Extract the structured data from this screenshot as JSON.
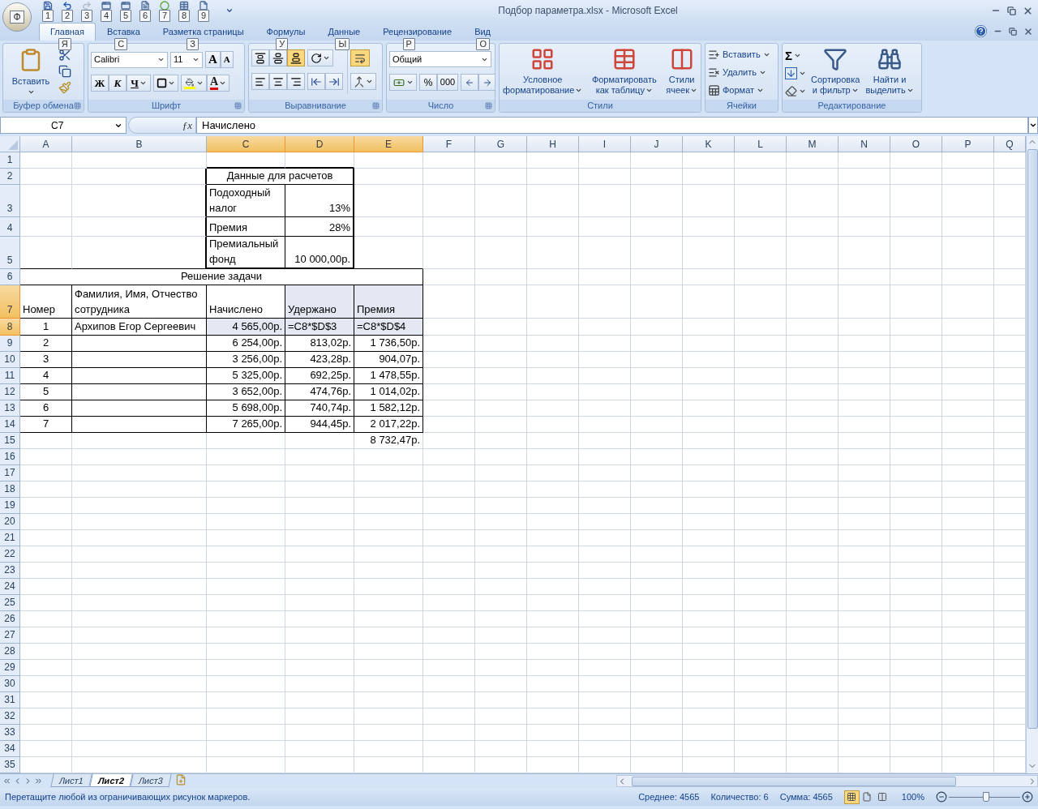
{
  "app": {
    "office_button": "Ф",
    "title": "Подбор параметра.xlsx - Microsoft Excel"
  },
  "quick_access": [
    {
      "kind": "save",
      "keytip": "1",
      "disabled": false
    },
    {
      "kind": "undo",
      "keytip": "2",
      "disabled": false
    },
    {
      "kind": "redo",
      "keytip": "3",
      "disabled": true
    },
    {
      "kind": "form",
      "keytip": "4",
      "disabled": false
    },
    {
      "kind": "form",
      "keytip": "5",
      "disabled": false
    },
    {
      "kind": "document",
      "keytip": "6",
      "disabled": false
    },
    {
      "kind": "circle",
      "keytip": "7",
      "disabled": false
    },
    {
      "kind": "table",
      "keytip": "8",
      "disabled": false
    },
    {
      "kind": "window",
      "keytip": "9",
      "disabled": false
    }
  ],
  "tabs": [
    {
      "label": "Главная",
      "keytip": "Я",
      "selected": true
    },
    {
      "label": "Вставка",
      "keytip": "С",
      "selected": false
    },
    {
      "label": "Разметка страницы",
      "keytip": "З",
      "selected": false
    },
    {
      "label": "Формулы",
      "keytip": "У",
      "selected": false
    },
    {
      "label": "Данные",
      "keytip": "Ы",
      "selected": false
    },
    {
      "label": "Рецензирование",
      "keytip": "Р",
      "selected": false
    },
    {
      "label": "Вид",
      "keytip": "О",
      "selected": false
    }
  ],
  "ribbon": {
    "clipboard": {
      "label": "Буфер обмена",
      "paste": "Вставить"
    },
    "font": {
      "label": "Шрифт",
      "font": "Calibri",
      "size": "11",
      "grow": "A",
      "shrink": "A",
      "bold": "Ж",
      "italic": "К",
      "underline": "Ч",
      "font_color": "A"
    },
    "alignment": {
      "label": "Выравнивание",
      "vertical": [
        {
          "kind": "top",
          "selected": false
        },
        {
          "kind": "middle",
          "selected": false
        },
        {
          "kind": "bottom",
          "selected": true
        }
      ],
      "wrap_text": {
        "selected": true
      }
    },
    "number": {
      "label": "Число",
      "format": "Общий",
      "percent": "%",
      "thousands": "000"
    },
    "styles": {
      "label": "Стили",
      "buttons": [
        {
          "kind": "conditional",
          "lines": [
            "Условное",
            "форматирование"
          ]
        },
        {
          "kind": "table",
          "lines": [
            "Форматировать",
            "как таблицу"
          ]
        },
        {
          "kind": "cell",
          "lines": [
            "Стили",
            "ячеек"
          ]
        }
      ]
    },
    "cells": {
      "label": "Ячейки",
      "buttons": [
        {
          "kind": "insert",
          "label": "Вставить"
        },
        {
          "kind": "delete",
          "label": "Удалить"
        },
        {
          "kind": "format",
          "label": "Формат"
        }
      ]
    },
    "editing": {
      "label": "Редактирование",
      "sum": "Σ",
      "buttons": [
        {
          "kind": "sort",
          "lines": [
            "Сортировка",
            "и фильтр"
          ]
        },
        {
          "kind": "find",
          "lines": [
            "Найти и",
            "выделить"
          ]
        }
      ]
    }
  },
  "formula_bar": {
    "name_box": "C7",
    "function_label": "ƒx",
    "formula": "Начислено"
  },
  "sheet": {
    "column_headers": [
      {
        "label": "A",
        "selected": false
      },
      {
        "label": "B",
        "selected": false
      },
      {
        "label": "C",
        "selected": true
      },
      {
        "label": "D",
        "selected": true
      },
      {
        "label": "E",
        "selected": true
      },
      {
        "label": "F",
        "selected": false
      },
      {
        "label": "G",
        "selected": false
      },
      {
        "label": "H",
        "selected": false
      },
      {
        "label": "I",
        "selected": false
      },
      {
        "label": "J",
        "selected": false
      },
      {
        "label": "K",
        "selected": false
      },
      {
        "label": "L",
        "selected": false
      },
      {
        "label": "M",
        "selected": false
      },
      {
        "label": "N",
        "selected": false
      },
      {
        "label": "O",
        "selected": false
      },
      {
        "label": "P",
        "selected": false
      },
      {
        "label": "Q",
        "selected": false
      }
    ],
    "row_headers": [
      {
        "label": "1",
        "selected": false
      },
      {
        "label": "2",
        "selected": false
      },
      {
        "label": "3",
        "selected": false
      },
      {
        "label": "4",
        "selected": false
      },
      {
        "label": "5",
        "selected": false
      },
      {
        "label": "6",
        "selected": false
      },
      {
        "label": "7",
        "selected": true
      },
      {
        "label": "8",
        "selected": true
      },
      {
        "label": "9",
        "selected": false
      },
      {
        "label": "10",
        "selected": false
      },
      {
        "label": "11",
        "selected": false
      },
      {
        "label": "12",
        "selected": false
      },
      {
        "label": "13",
        "selected": false
      },
      {
        "label": "14",
        "selected": false
      },
      {
        "label": "15",
        "selected": false
      },
      {
        "label": "16",
        "selected": false
      },
      {
        "label": "17",
        "selected": false
      },
      {
        "label": "18",
        "selected": false
      },
      {
        "label": "19",
        "selected": false
      },
      {
        "label": "20",
        "selected": false
      },
      {
        "label": "21",
        "selected": false
      },
      {
        "label": "22",
        "selected": false
      },
      {
        "label": "23",
        "selected": false
      },
      {
        "label": "24",
        "selected": false
      },
      {
        "label": "25",
        "selected": false
      },
      {
        "label": "26",
        "selected": false
      },
      {
        "label": "27",
        "selected": false
      },
      {
        "label": "28",
        "selected": false
      },
      {
        "label": "29",
        "selected": false
      },
      {
        "label": "30",
        "selected": false
      },
      {
        "label": "31",
        "selected": false
      },
      {
        "label": "32",
        "selected": false
      },
      {
        "label": "33",
        "selected": false
      },
      {
        "label": "34",
        "selected": false
      },
      {
        "label": "35",
        "selected": false
      }
    ],
    "data_block": {
      "title": "Данные для расчетов",
      "rows": [
        {
          "label": "Подоходный налог",
          "value": "13%"
        },
        {
          "label": "Премия",
          "value": "28%"
        },
        {
          "label": "Премиальный фонд",
          "value": "10 000,00р."
        }
      ]
    },
    "task": {
      "title": "Решение задачи",
      "columns": [
        "Номер",
        "Фамилия, Имя, Отчество сотрудника",
        "Начислено",
        "Удержано",
        "Премия"
      ],
      "rows": [
        {
          "kind": "formula",
          "number": "1",
          "name": "Архипов Егор Сергеевич",
          "accrued": "4 565,00р.",
          "withheld": "=C8*$D$3",
          "bonus": "=C8*$D$4"
        },
        {
          "kind": "value",
          "number": "2",
          "accrued": "6 254,00р.",
          "withheld": "813,02р.",
          "bonus": "1 736,50р."
        },
        {
          "kind": "value",
          "number": "3",
          "accrued": "3 256,00р.",
          "withheld": "423,28р.",
          "bonus": "904,07р."
        },
        {
          "kind": "value",
          "number": "4",
          "accrued": "5 325,00р.",
          "withheld": "692,25р.",
          "bonus": "1 478,55р."
        },
        {
          "kind": "value",
          "number": "5",
          "accrued": "3 652,00р.",
          "withheld": "474,76р.",
          "bonus": "1 014,02р."
        },
        {
          "kind": "value",
          "number": "6",
          "accrued": "5 698,00р.",
          "withheld": "740,74р.",
          "bonus": "1 582,12р."
        },
        {
          "kind": "value",
          "number": "7",
          "accrued": "7 265,00р.",
          "withheld": "944,45р.",
          "bonus": "2 017,22р."
        }
      ],
      "total": "8 732,47р."
    }
  },
  "sheet_tabs": [
    {
      "label": "Лист1",
      "selected": false
    },
    {
      "label": "Лист2",
      "selected": true
    },
    {
      "label": "Лист3",
      "selected": false
    }
  ],
  "status_bar": {
    "message": "Перетащите любой из ограничивающих рисунок маркеров.",
    "average": "Среднее: 4565",
    "count": "Количество: 6",
    "sum": "Сумма: 4565",
    "views": [
      {
        "kind": "normal",
        "selected": true
      },
      {
        "kind": "page-layout",
        "selected": false
      },
      {
        "kind": "page-break",
        "selected": false
      }
    ],
    "zoom": "100%",
    "zoom_slider": {
      "level": 0.52
    }
  }
}
